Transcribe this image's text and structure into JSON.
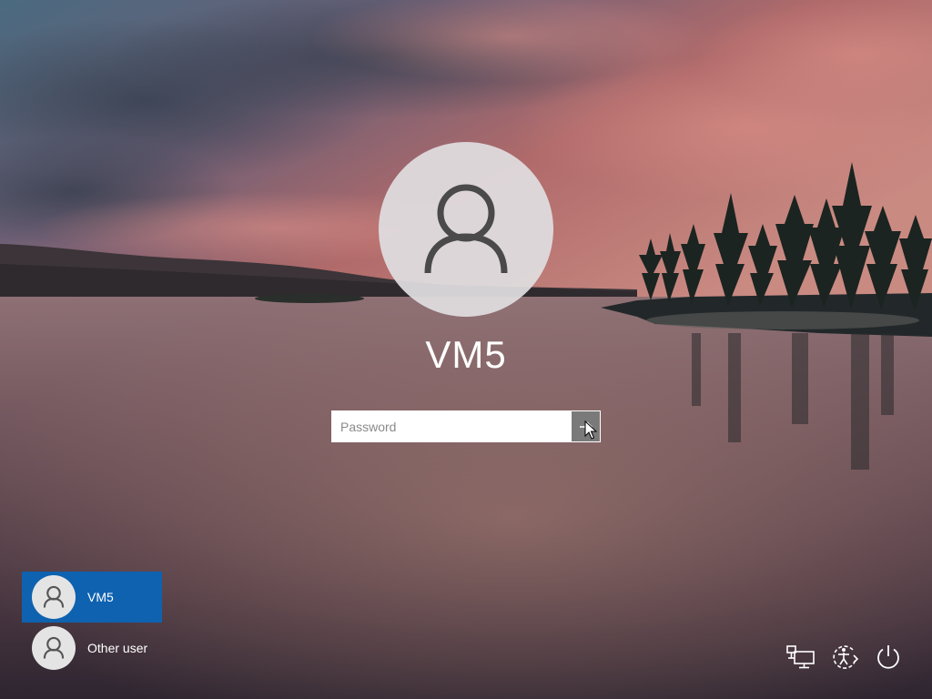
{
  "login": {
    "username": "VM5",
    "password": {
      "placeholder": "Password",
      "value": ""
    }
  },
  "users": [
    {
      "name": "VM5",
      "selected": true
    },
    {
      "name": "Other user",
      "selected": false
    }
  ],
  "system_icons": [
    "network-icon",
    "ease-of-access-icon",
    "power-icon"
  ],
  "colors": {
    "selected_user_bg": "#0e62b0",
    "submit_button_bg": "#7a7a7a",
    "avatar_bg": "#e0dee0"
  }
}
